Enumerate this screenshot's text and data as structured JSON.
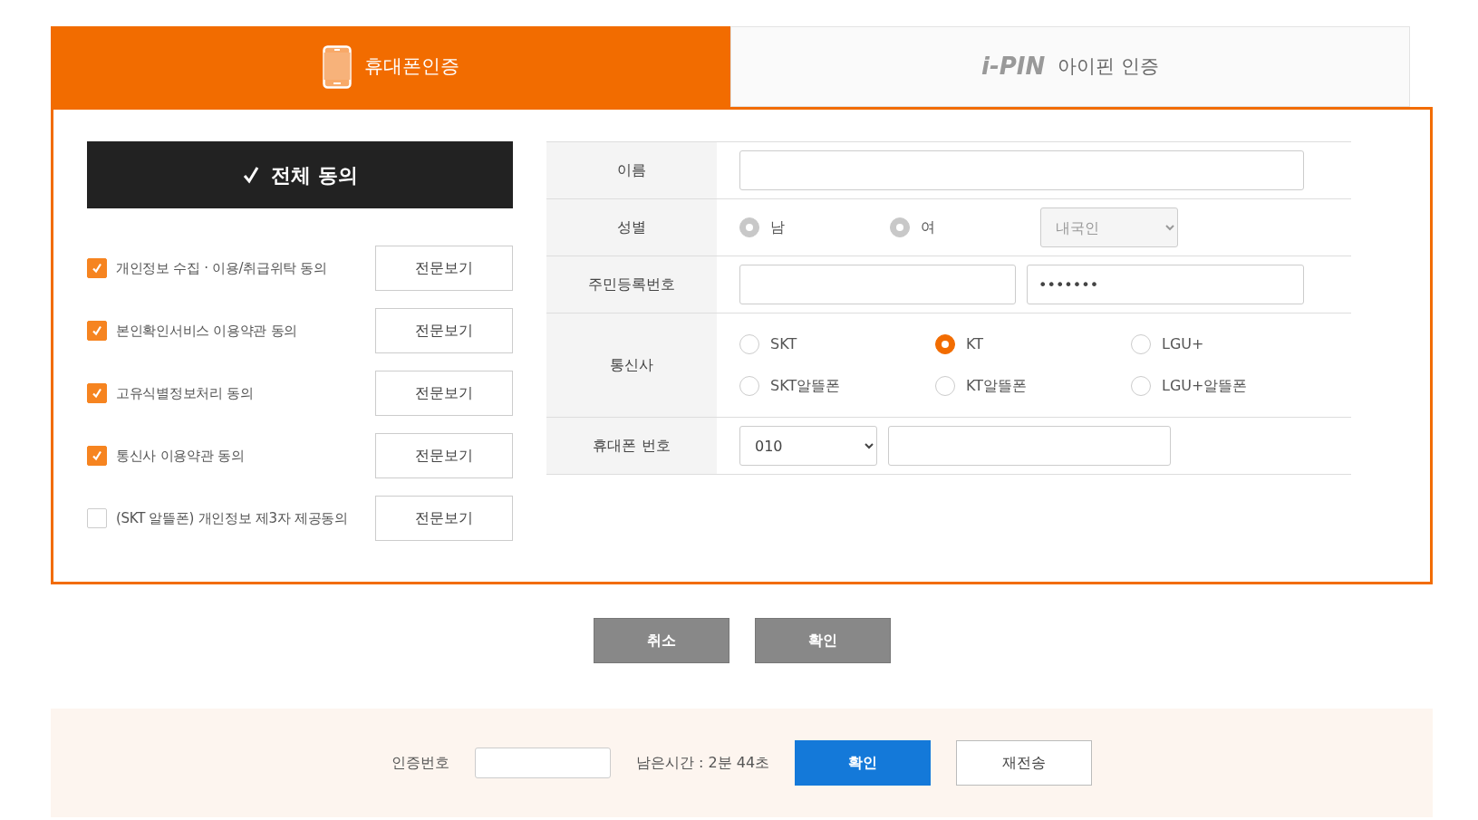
{
  "tabs": [
    {
      "label": "휴대폰인증",
      "kind": "phone",
      "selected": true
    },
    {
      "label": "아이핀 인증",
      "logo": "i-PIN",
      "kind": "ipin",
      "selected": false
    }
  ],
  "agree_all": {
    "label": "전체 동의",
    "checked": true
  },
  "agreements": [
    {
      "label": "개인정보 수집 · 이용/취급위탁 동의",
      "checked": true,
      "button": "전문보기"
    },
    {
      "label": "본인확인서비스 이용약관 동의",
      "checked": true,
      "button": "전문보기"
    },
    {
      "label": "고유식별정보처리 동의",
      "checked": true,
      "button": "전문보기"
    },
    {
      "label": "통신사 이용약관 동의",
      "checked": true,
      "button": "전문보기"
    },
    {
      "label": "(SKT 알뜰폰) 개인정보 제3자 제공동의",
      "checked": false,
      "button": "전문보기"
    }
  ],
  "form": {
    "name_label": "이름",
    "gender": {
      "label": "성별",
      "options": [
        {
          "label": "남",
          "selected": false,
          "disabled": true
        },
        {
          "label": "여",
          "selected": false,
          "disabled": true
        }
      ],
      "nationality": {
        "value": "내국인",
        "disabled": true
      }
    },
    "resident": {
      "label": "주민등록번호",
      "back_value": "•••••••"
    },
    "carrier": {
      "label": "통신사",
      "options": [
        {
          "label": "SKT",
          "selected": false
        },
        {
          "label": "KT",
          "selected": true
        },
        {
          "label": "LGU+",
          "selected": false
        },
        {
          "label": "SKT알뜰폰",
          "selected": false
        },
        {
          "label": "KT알뜰폰",
          "selected": false
        },
        {
          "label": "LGU+알뜰폰",
          "selected": false
        }
      ]
    },
    "phone": {
      "label": "휴대폰 번호",
      "prefix": "010"
    }
  },
  "buttons": [
    "취소",
    "확인"
  ],
  "verify": {
    "label": "인증번호",
    "timer": "남은시간 : 2분 44초",
    "confirm": "확인",
    "resend": "재전송"
  }
}
